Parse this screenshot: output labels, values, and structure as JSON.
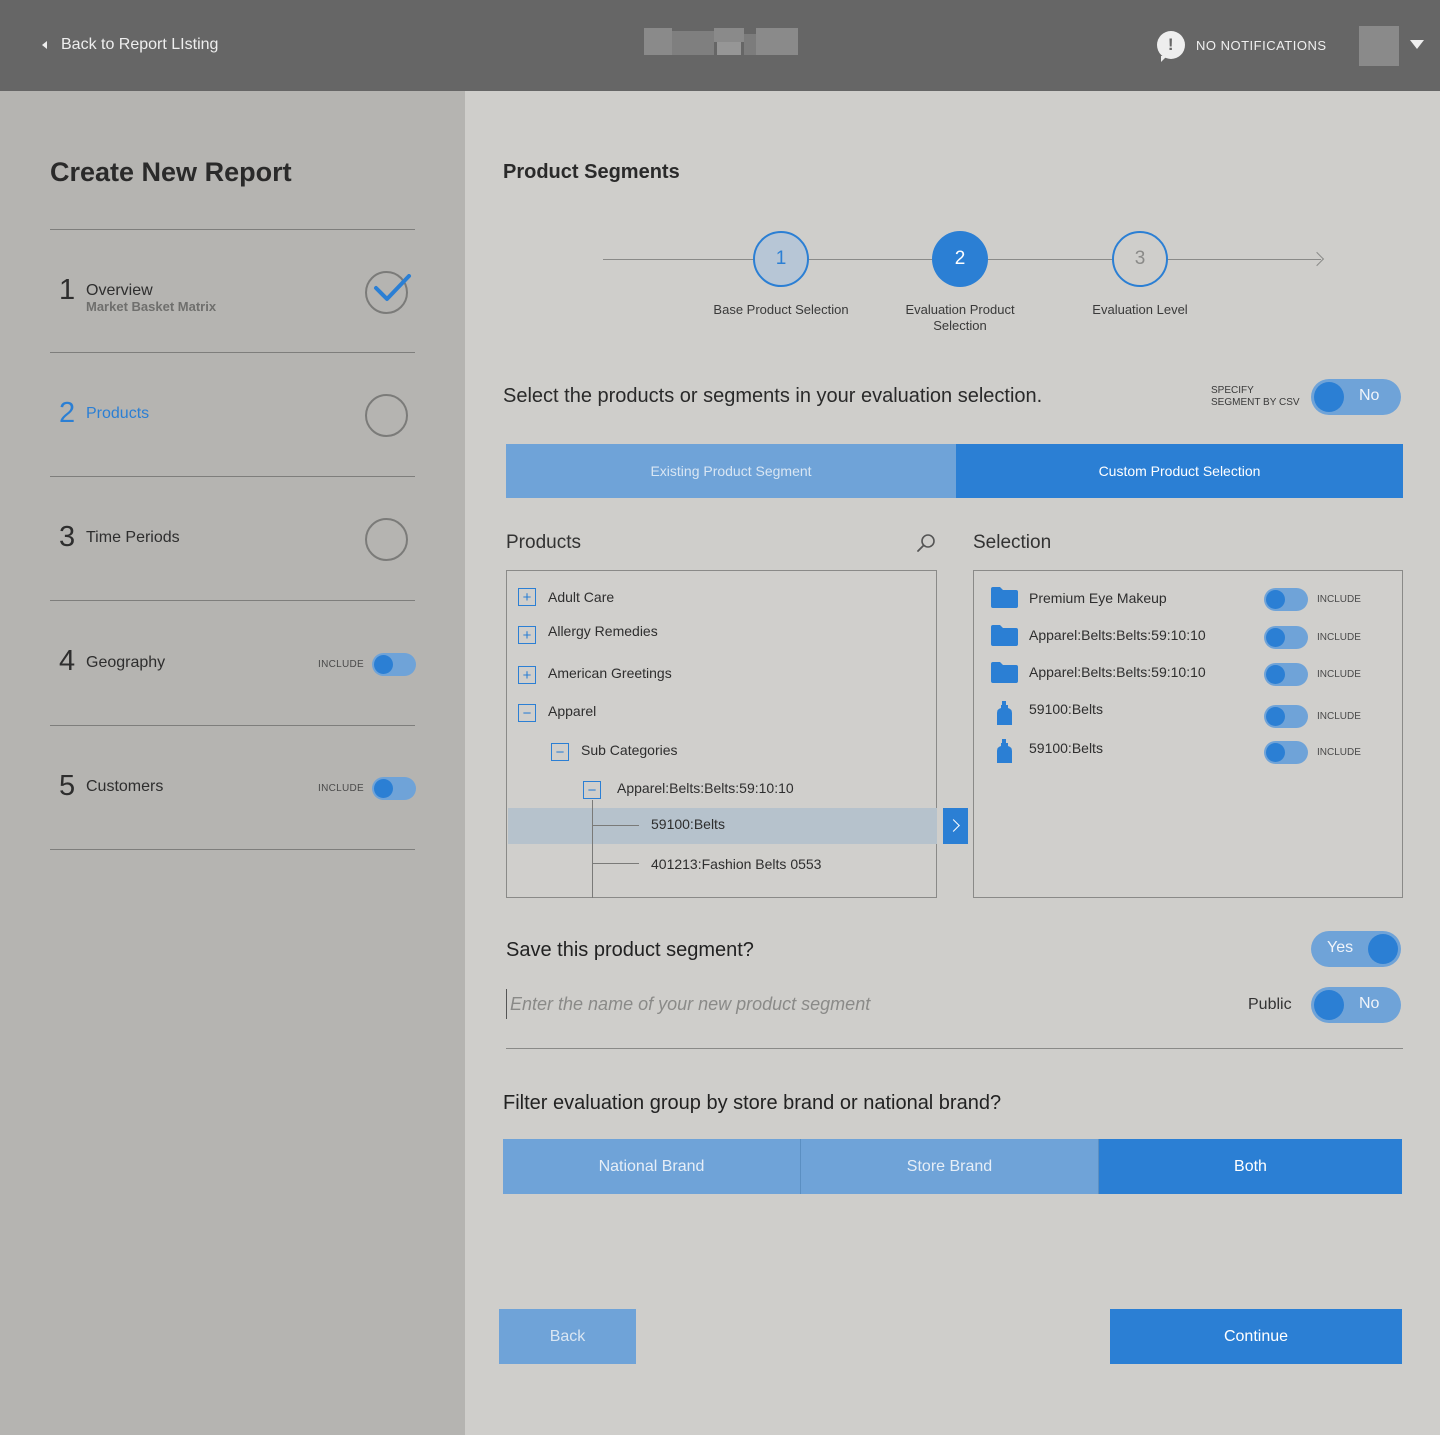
{
  "topbar": {
    "back_label": "Back to Report LIsting",
    "notifications_label": "NO NOTIFICATIONS",
    "notifications_icon": "!"
  },
  "sidebar": {
    "title": "Create New Report",
    "steps": [
      {
        "num": "1",
        "label": "Overview",
        "sub": "Market Basket Matrix",
        "status": "complete"
      },
      {
        "num": "2",
        "label": "Products",
        "status": "active"
      },
      {
        "num": "3",
        "label": "Time Periods",
        "status": "pending"
      },
      {
        "num": "4",
        "label": "Geography",
        "include_label": "INCLUDE",
        "include": false
      },
      {
        "num": "5",
        "label": "Customers",
        "include_label": "INCLUDE",
        "include": false
      }
    ]
  },
  "main": {
    "title": "Product Segments",
    "stepper": [
      {
        "num": "1",
        "label": "Base Product Selection",
        "state": "done"
      },
      {
        "num": "2",
        "label": "Evaluation Product Selection",
        "state": "current"
      },
      {
        "num": "3",
        "label": "Evaluation Level",
        "state": "todo"
      }
    ],
    "prompt": "Select the products or segments in your evaluation selection.",
    "csv": {
      "label_line1": "SPECIFY",
      "label_line2": "SEGMENT BY CSV",
      "value": "No"
    },
    "segment_tabs": {
      "existing": "Existing Product Segment",
      "custom": "Custom Product Selection",
      "selected": "custom"
    },
    "products": {
      "title": "Products",
      "tree": [
        {
          "label": "Adult Care",
          "toggle": "+"
        },
        {
          "label": "Allergy Remedies",
          "toggle": "+"
        },
        {
          "label": "American Greetings",
          "toggle": "+"
        },
        {
          "label": "Apparel",
          "toggle": "−"
        },
        {
          "label": "Sub Categories",
          "toggle": "−"
        },
        {
          "label": "Apparel:Belts:Belts:59:10:10",
          "toggle": "−"
        },
        {
          "label": "59100:Belts",
          "selected": true
        },
        {
          "label": "401213:Fashion Belts 0553"
        }
      ]
    },
    "selection": {
      "title": "Selection",
      "items": [
        {
          "name": "Premium Eye Makeup",
          "icon": "folder-icon",
          "include_label": "INCLUDE"
        },
        {
          "name": "Apparel:Belts:Belts:59:10:10",
          "icon": "folder-icon",
          "include_label": "INCLUDE"
        },
        {
          "name": "Apparel:Belts:Belts:59:10:10",
          "icon": "folder-icon",
          "include_label": "INCLUDE"
        },
        {
          "name": "59100:Belts",
          "icon": "bottle-icon",
          "include_label": "INCLUDE"
        },
        {
          "name": "59100:Belts",
          "icon": "bottle-icon",
          "include_label": "INCLUDE"
        }
      ]
    },
    "save": {
      "question": "Save this product segment?",
      "value": "Yes",
      "name_placeholder": "Enter the name of your new product segment",
      "public_label": "Public",
      "public_value": "No"
    },
    "filter": {
      "question": "Filter evaluation group by store brand or national brand?",
      "options": [
        "National Brand",
        "Store Brand",
        "Both"
      ],
      "selected": "Both"
    },
    "buttons": {
      "back": "Back",
      "continue": "Continue"
    }
  },
  "colors": {
    "accent": "#2b7fd4",
    "accent_light": "#6fa3d8",
    "topbar": "#666666",
    "sidebar": "#b5b4b1",
    "content": "#cfcecb"
  }
}
